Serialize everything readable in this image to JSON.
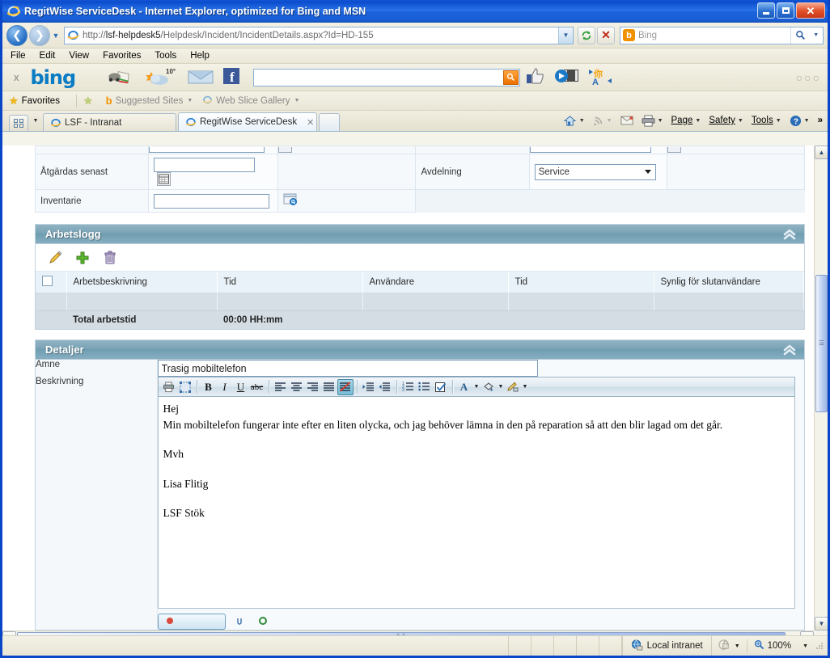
{
  "window": {
    "title": "RegitWise ServiceDesk - Internet Explorer, optimized for Bing and MSN",
    "minimize_label": "–",
    "maximize_label": "❐",
    "close_label": "✕"
  },
  "address_bar": {
    "url_host": "lsf-helpdesk5",
    "url_prefix": "http://",
    "url_path": "/Helpdesk/Incident/IncidentDetails.aspx?Id=HD-155",
    "refresh_label": "↺",
    "stop_label": "✕"
  },
  "search_bar": {
    "provider": "Bing",
    "placeholder": "Bing",
    "value": ""
  },
  "menu": {
    "items": [
      "File",
      "Edit",
      "View",
      "Favorites",
      "Tools",
      "Help"
    ]
  },
  "bing_toolbar": {
    "close_label": "x",
    "logo": "bing",
    "weather_temp": "10°",
    "search_value": "",
    "overflow": "○○○"
  },
  "favorites_bar": {
    "favorites_label": "Favorites",
    "suggested_sites": "Suggested Sites",
    "web_slice_gallery": "Web Slice Gallery"
  },
  "tabs": [
    {
      "label": "LSF - Intranat",
      "active": false
    },
    {
      "label": "RegitWise ServiceDesk",
      "active": true,
      "close_label": "✕"
    }
  ],
  "command_bar": {
    "items": [
      "Page",
      "Safety",
      "Tools"
    ],
    "overflow": "»"
  },
  "form_fields": {
    "atgardas_senast": {
      "label": "Åtgärdas senast",
      "value": ""
    },
    "inventarie": {
      "label": "Inventarie",
      "value": ""
    },
    "avdelning": {
      "label": "Avdelning",
      "value": "Service"
    }
  },
  "arbetslogg": {
    "title": "Arbetslogg",
    "collapse_label": "«",
    "tools": [
      "edit-icon",
      "add-icon",
      "delete-icon"
    ],
    "columns": [
      "",
      "Arbetsbeskrivning",
      "Tid",
      "Användare",
      "Tid",
      "Synlig för slutanvändare"
    ],
    "rows": [],
    "total_label": "Total arbetstid",
    "total_value": "00:00 HH:mm"
  },
  "detaljer": {
    "title": "Detaljer",
    "collapse_label": "«",
    "amne": {
      "label": "Ämne",
      "value": "Trasig mobiltelefon"
    },
    "beskrivning": {
      "label": "Beskrivning",
      "lines": [
        "Hej",
        "Min mobiltelefon fungerar inte efter en liten olycka, och jag behöver lämna in den på reparation så att den blir lagad om det går.",
        "Mvh",
        "Lisa Flitig",
        "LSF Stök"
      ]
    },
    "editor_toolbar": [
      {
        "name": "print-icon",
        "glyph": "⎙",
        "active": false
      },
      {
        "name": "select-all-icon",
        "glyph": "⬚",
        "active": false
      },
      {
        "name": "bold-icon",
        "glyph": "B",
        "active": false
      },
      {
        "name": "italic-icon",
        "glyph": "I",
        "active": false
      },
      {
        "name": "underline-icon",
        "glyph": "U",
        "active": false
      },
      {
        "name": "strikethrough-icon",
        "glyph": "abc",
        "active": false
      },
      {
        "name": "align-left-icon",
        "glyph": "≡",
        "active": false
      },
      {
        "name": "align-center-icon",
        "glyph": "≡",
        "active": false
      },
      {
        "name": "align-right-icon",
        "glyph": "≡",
        "active": false
      },
      {
        "name": "align-justify-icon",
        "glyph": "≡",
        "active": false
      },
      {
        "name": "remove-format-icon",
        "glyph": "≡",
        "active": true
      },
      {
        "name": "indent-increase-icon",
        "glyph": "⇥",
        "active": false
      },
      {
        "name": "indent-decrease-icon",
        "glyph": "⇤",
        "active": false
      },
      {
        "name": "ordered-list-icon",
        "glyph": "≡",
        "active": false
      },
      {
        "name": "bullet-list-icon",
        "glyph": "≡",
        "active": false
      },
      {
        "name": "checkbox-icon",
        "glyph": "☑",
        "active": false
      },
      {
        "name": "font-color-icon",
        "glyph": "A",
        "active": false
      },
      {
        "name": "fill-color-icon",
        "glyph": "◇",
        "active": false
      },
      {
        "name": "format-painter-icon",
        "glyph": "✎",
        "active": false
      }
    ]
  },
  "status_bar": {
    "zone": "Local intranet",
    "zone_icon": "globe-icon",
    "protected_mode_icon": "lock-icon",
    "zoom": "100%",
    "zoom_icon": "magnifier-icon"
  }
}
